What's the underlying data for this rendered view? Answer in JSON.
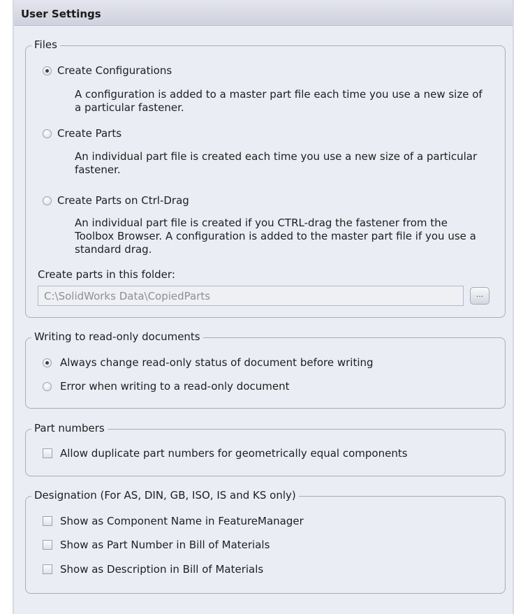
{
  "header": {
    "title": "User Settings"
  },
  "files": {
    "legend": "Files",
    "options": [
      {
        "label": "Create Configurations",
        "selected": true,
        "description_lines": [
          "A configuration is added to a master part file each time you use a new size of",
          "a particular fastener."
        ]
      },
      {
        "label": "Create Parts",
        "selected": false,
        "description_lines": [
          "An individual part file is created each time you use a new size of a particular",
          "fastener."
        ]
      },
      {
        "label": "Create Parts on Ctrl-Drag",
        "selected": false,
        "description_lines": [
          "An individual part file is created if you CTRL-drag the fastener from the",
          "Toolbox Browser. A configuration is added to the master part file if you use a",
          "standard drag."
        ]
      }
    ],
    "folder_label": "Create parts in this folder:",
    "folder_value": "C:\\SolidWorks Data\\CopiedParts",
    "browse_label": "..."
  },
  "readonly": {
    "legend": "Writing to read-only documents",
    "options": [
      {
        "label": "Always change read-only status of document before writing",
        "selected": true
      },
      {
        "label": "Error when writing to a read-only document",
        "selected": false
      }
    ]
  },
  "part_numbers": {
    "legend": "Part numbers",
    "checkbox_label": "Allow duplicate part numbers for geometrically equal components",
    "checked": false
  },
  "designation": {
    "legend": "Designation (For AS, DIN, GB, ISO, IS and KS only)",
    "checkboxes": [
      {
        "label": "Show as Component Name in FeatureManager",
        "checked": false
      },
      {
        "label": "Show as Part Number in Bill of Materials",
        "checked": false
      },
      {
        "label": "Show as Description in Bill of Materials",
        "checked": false
      }
    ]
  }
}
